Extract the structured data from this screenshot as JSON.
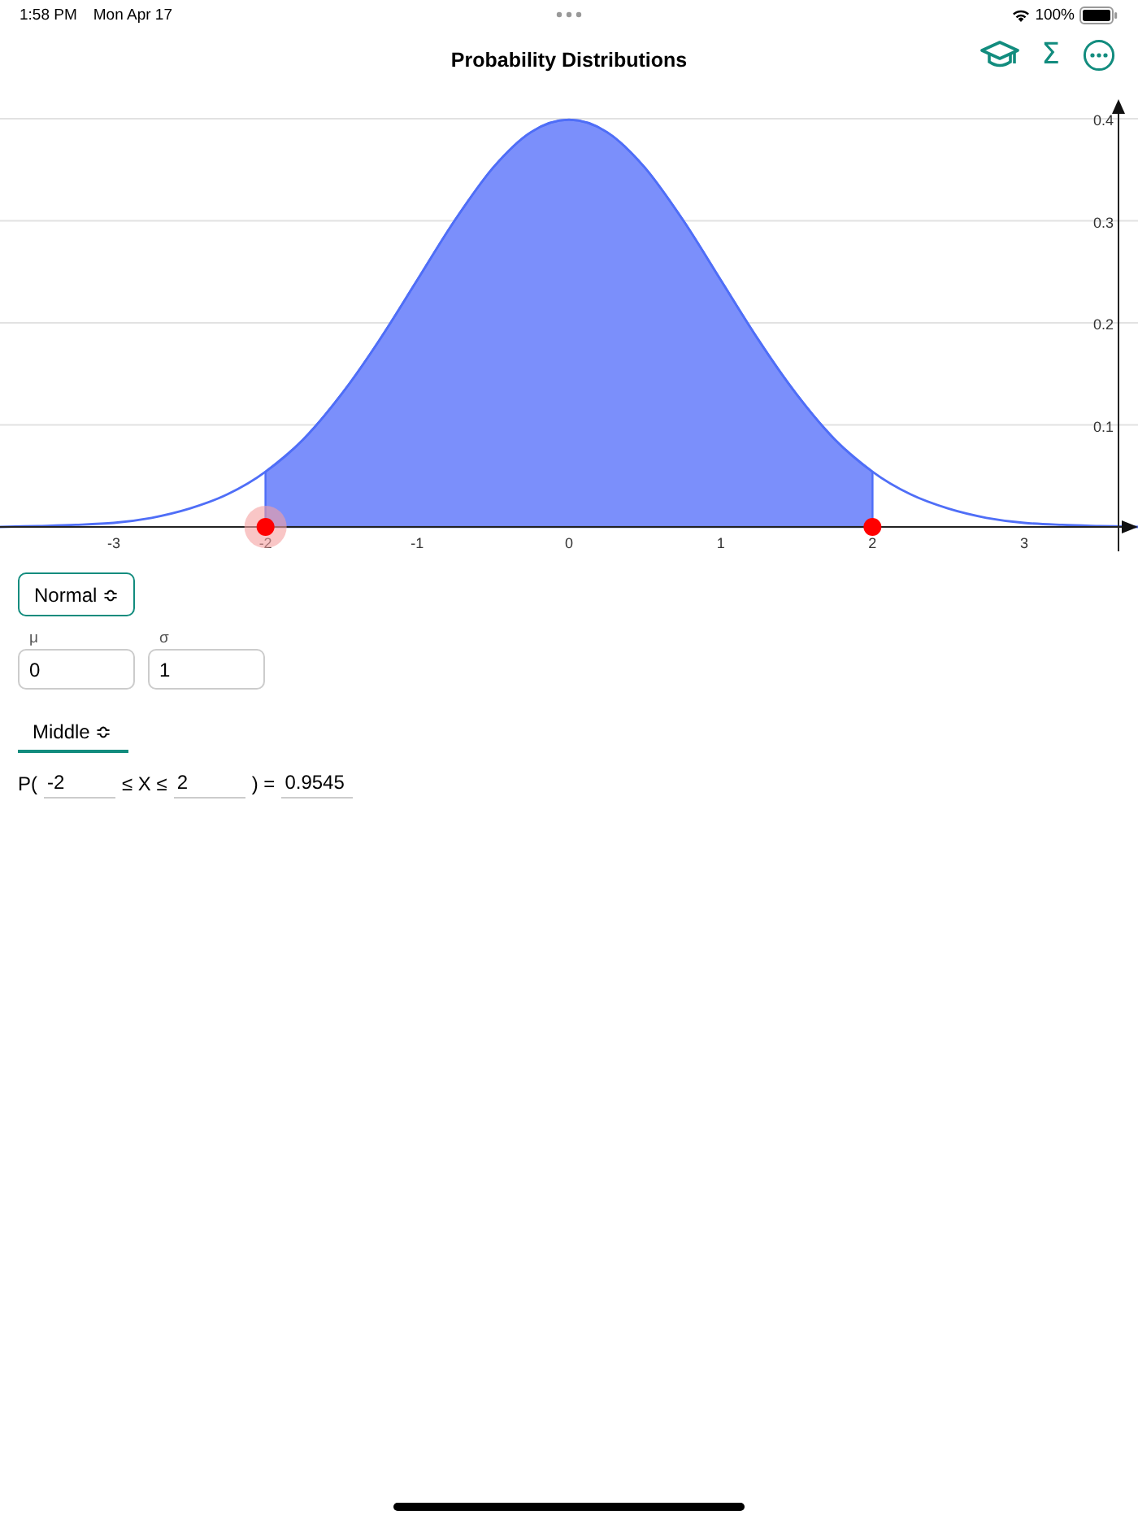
{
  "status_bar": {
    "time": "1:58 PM",
    "date": "Mon Apr 17",
    "battery": "100%"
  },
  "nav": {
    "title": "Probability Distributions",
    "actions": [
      {
        "kind": "cap"
      },
      {
        "kind": "text",
        "label": "Σ"
      },
      {
        "kind": "more"
      }
    ]
  },
  "chart": {
    "chart_data": {
      "type": "line",
      "x": [
        -3.75,
        -3.5,
        -3.25,
        -3,
        -2.75,
        -2.5,
        -2.25,
        -2,
        -1.75,
        -1.5,
        -1.25,
        -1,
        -0.75,
        -0.5,
        -0.25,
        0,
        0.25,
        0.5,
        0.75,
        1,
        1.25,
        1.5,
        1.75,
        2,
        2.25,
        2.5,
        2.75,
        3,
        3.25,
        3.5,
        3.75
      ],
      "series": [
        {
          "color": "#4f6ef7",
          "values": [
            0,
            0.001,
            0.002,
            0.004,
            0.009,
            0.018,
            0.032,
            0.054,
            0.086,
            0.13,
            0.183,
            0.242,
            0.301,
            0.352,
            0.387,
            0.399,
            0.387,
            0.352,
            0.301,
            0.242,
            0.183,
            0.13,
            0.086,
            0.054,
            0.032,
            0.018,
            0.009,
            0.004,
            0.002,
            0.001,
            0
          ]
        }
      ],
      "xlim": [
        -3.75,
        3.75
      ],
      "xticks": [
        -3,
        -2,
        -1,
        0,
        1,
        2,
        3
      ],
      "yticks": [
        0.1,
        0.2,
        0.3,
        0.4
      ],
      "ylim": [
        0,
        0.4
      ],
      "grid": true
    }
  },
  "distribution": {
    "label": "Normal",
    "arrows": "≎"
  },
  "parameters": [
    {
      "label": "μ",
      "value": "0"
    },
    {
      "label": "σ",
      "value": "1"
    }
  ],
  "probability": {
    "mode": "Middle",
    "prefix": "P(",
    "lower": {
      "value": "-2",
      "active": true
    },
    "middle": "≤ X ≤",
    "upper": {
      "value": "2",
      "active": false
    },
    "equals": ") =",
    "result": "0.9545"
  }
}
